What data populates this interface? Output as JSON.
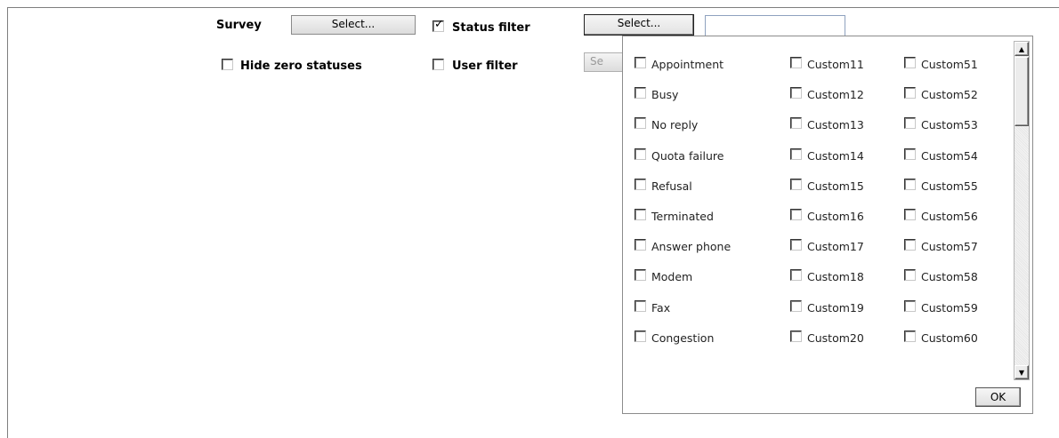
{
  "toolbar": {
    "survey_label": "Survey",
    "survey_select": "Select...",
    "status_filter_label": "Status filter",
    "status_filter_checked": true,
    "status_select": "Select...",
    "status_text_value": "",
    "hide_zero_label": "Hide zero statuses",
    "hide_zero_checked": false,
    "user_filter_label": "User filter",
    "user_filter_checked": false,
    "user_select_partial": "Se"
  },
  "status_popup": {
    "columns": [
      [
        "Appointment",
        "Busy",
        "No reply",
        "Quota failure",
        "Refusal",
        "Terminated",
        "Answer phone",
        "Modem",
        "Fax",
        "Congestion"
      ],
      [
        "Custom11",
        "Custom12",
        "Custom13",
        "Custom14",
        "Custom15",
        "Custom16",
        "Custom17",
        "Custom18",
        "Custom19",
        "Custom20"
      ],
      [
        "Custom51",
        "Custom52",
        "Custom53",
        "Custom54",
        "Custom55",
        "Custom56",
        "Custom57",
        "Custom58",
        "Custom59",
        "Custom60"
      ]
    ],
    "ok_label": "OK",
    "scroll_up_icon": "arrow-up-icon",
    "scroll_down_icon": "arrow-down-icon"
  }
}
